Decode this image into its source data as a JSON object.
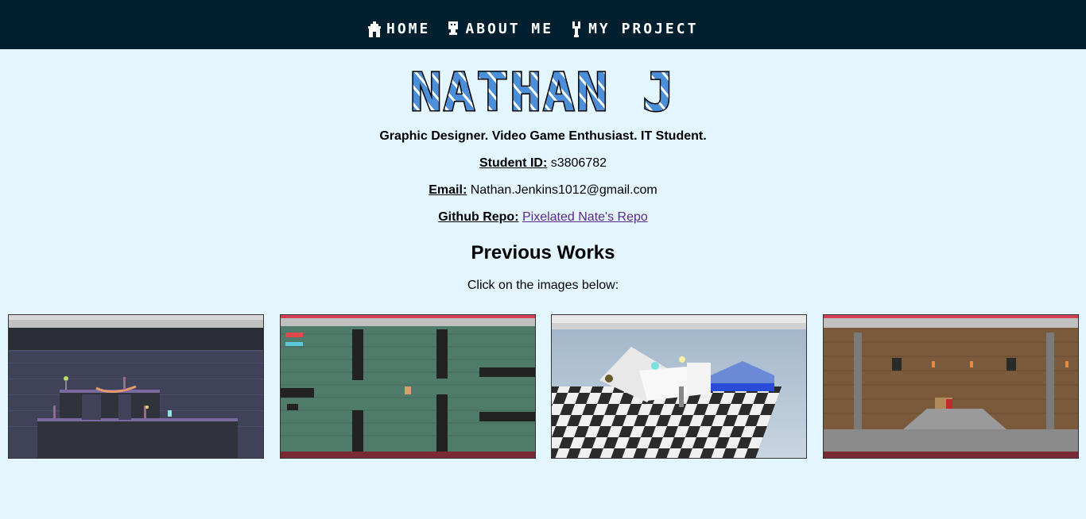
{
  "nav": {
    "items": [
      {
        "label": "HOME",
        "icon": "house-icon"
      },
      {
        "label": "ABOUT ME",
        "icon": "person-icon"
      },
      {
        "label": "MY PROJECT",
        "icon": "wrench-icon"
      }
    ]
  },
  "header": {
    "logo_text": "NATHAN J",
    "tagline": "Graphic Designer. Video Game Enthusiast. IT Student."
  },
  "info": {
    "student_id_label": "Student ID:",
    "student_id_value": "s3806782",
    "email_label": "Email:",
    "email_value": "Nathan.Jenkins1012@gmail.com",
    "github_label": "Github Repo:",
    "github_link": "Pixelated Nate's Repo"
  },
  "works": {
    "title": "Previous Works",
    "hint": "Click on the images below:",
    "images": [
      {
        "icon": "graveyard-platformer-screenshot"
      },
      {
        "icon": "dungeon-topdown-screenshot"
      },
      {
        "icon": "3d-scene-screenshot"
      },
      {
        "icon": "castle-platformer-screenshot"
      }
    ]
  },
  "colors": {
    "nav_bg": "#002030",
    "page_bg": "#e3f6ff",
    "logo_fill": "#4a8fd8",
    "link": "#5a2a8a"
  }
}
